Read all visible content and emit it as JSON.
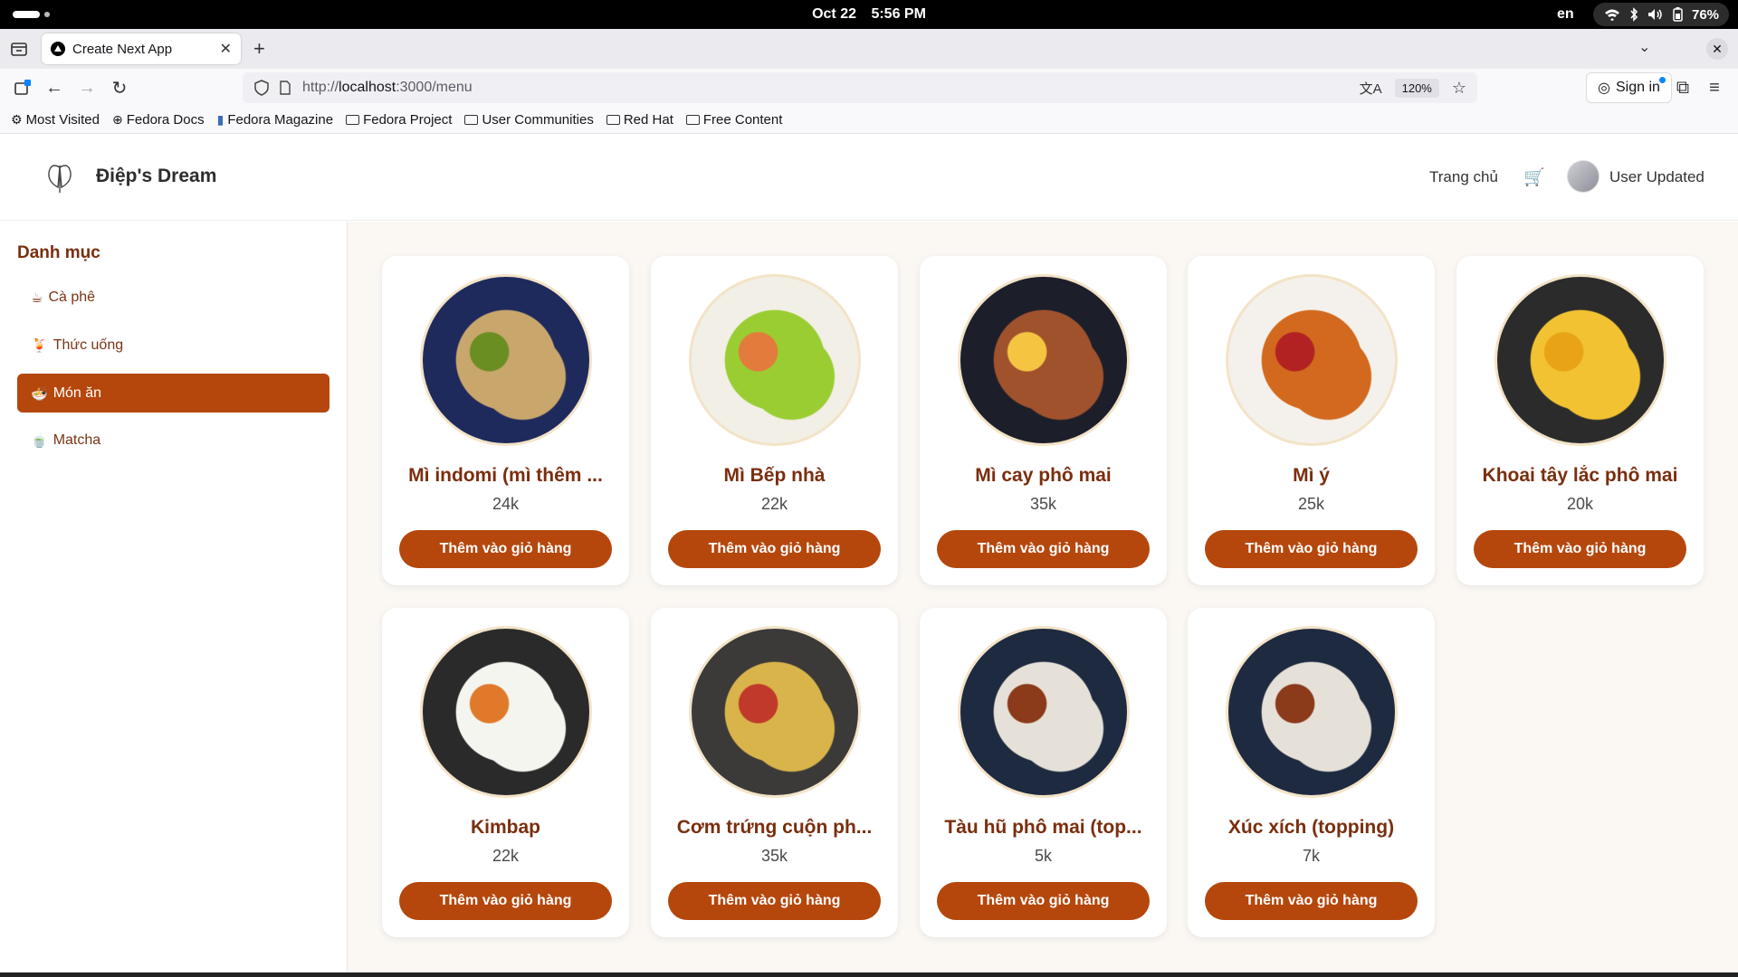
{
  "os": {
    "date": "Oct 22",
    "time": "5:56 PM",
    "lang": "en",
    "battery": "76%"
  },
  "browser": {
    "tab_title": "Create Next App",
    "url_prefix": "http://",
    "url_host": "localhost",
    "url_rest": ":3000/menu",
    "zoom": "120%",
    "sign_in": "Sign in"
  },
  "bookmarks": [
    {
      "label": "Most Visited",
      "icon": "gear-icon"
    },
    {
      "label": "Fedora Docs",
      "icon": "globe-icon"
    },
    {
      "label": "Fedora Magazine",
      "icon": "fedora-icon"
    },
    {
      "label": "Fedora Project",
      "icon": "folder-icon"
    },
    {
      "label": "User Communities",
      "icon": "folder-icon"
    },
    {
      "label": "Red Hat",
      "icon": "folder-icon"
    },
    {
      "label": "Free Content",
      "icon": "folder-icon"
    }
  ],
  "header": {
    "brand": "Điệp's Dream",
    "home": "Trang chủ",
    "cart": "🛒",
    "user": "User Updated"
  },
  "sidebar": {
    "title": "Danh mục",
    "items": [
      {
        "emoji": "☕",
        "label": "Cà phê",
        "active": false
      },
      {
        "emoji": "🍹",
        "label": "Thức uống",
        "active": false
      },
      {
        "emoji": "🍜",
        "label": "Món ăn",
        "active": true
      },
      {
        "emoji": "🍵",
        "label": "Matcha",
        "active": false
      }
    ]
  },
  "products": [
    {
      "name": "Mì indomi (mì thêm ...",
      "price": "24k",
      "button": "Thêm vào giỏ hàng",
      "colors": [
        "#1f2a5c",
        "#c9a66b",
        "#6b8e23"
      ]
    },
    {
      "name": "Mì Bếp nhà",
      "price": "22k",
      "button": "Thêm vào giỏ hàng",
      "colors": [
        "#f2efe6",
        "#9acd32",
        "#e27b3c"
      ]
    },
    {
      "name": "Mì cay phô mai",
      "price": "35k",
      "button": "Thêm vào giỏ hàng",
      "colors": [
        "#1c1f2a",
        "#a0522d",
        "#f5c542"
      ]
    },
    {
      "name": "Mì ý",
      "price": "25k",
      "button": "Thêm vào giỏ hàng",
      "colors": [
        "#f4f1ec",
        "#d2691e",
        "#b22222"
      ]
    },
    {
      "name": "Khoai tây lắc phô mai",
      "price": "20k",
      "button": "Thêm vào giỏ hàng",
      "colors": [
        "#2b2b2b",
        "#f2c232",
        "#e8a317"
      ]
    },
    {
      "name": "Kimbap",
      "price": "22k",
      "button": "Thêm vào giỏ hàng",
      "colors": [
        "#2a2a2a",
        "#f5f5f0",
        "#e07a2a"
      ]
    },
    {
      "name": "Cơm trứng cuộn ph...",
      "price": "35k",
      "button": "Thêm vào giỏ hàng",
      "colors": [
        "#3c3a38",
        "#d9b44a",
        "#c0392b"
      ]
    },
    {
      "name": "Tàu hũ phô mai (top...",
      "price": "5k",
      "button": "Thêm vào giỏ hàng",
      "colors": [
        "#1e2a40",
        "#e6e1d8",
        "#8b3a1a"
      ]
    },
    {
      "name": "Xúc xích (topping)",
      "price": "7k",
      "button": "Thêm vào giỏ hàng",
      "colors": [
        "#1e2a40",
        "#e6e1d8",
        "#8b3a1a"
      ]
    }
  ],
  "theme": {
    "accent": "#b5470d",
    "title_color": "#7a2e0e"
  }
}
